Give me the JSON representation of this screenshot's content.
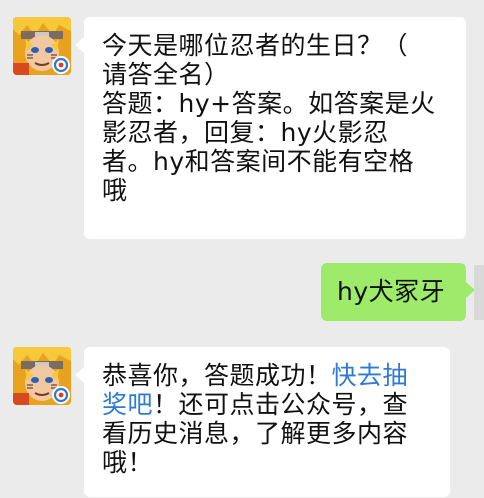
{
  "colors": {
    "background": "#ebebeb",
    "incoming_bubble": "#ffffff",
    "outgoing_bubble": "#9eea6a",
    "link": "#2e7ad6"
  },
  "messages": [
    {
      "sender": "official-account",
      "avatar_icon": "naruto-game-avatar-icon",
      "lines": [
        "今天是哪位忍者的生日？（",
        "请答全名）",
        "答题：hy+答案。如答案是火",
        "影忍者，回复：hy火影忍",
        "者。hy和答案间不能有空格",
        "哦"
      ]
    },
    {
      "sender": "user",
      "text": "hy犬冢牙"
    },
    {
      "sender": "official-account",
      "avatar_icon": "naruto-game-avatar-icon",
      "line1_prefix": "恭喜你，答题成功！",
      "line1_link": "快去抽",
      "line2_link": "奖吧",
      "line2_suffix": "！还可点击公众号，查",
      "line3": "看历史消息，了解更多内容",
      "line4": "哦！"
    }
  ]
}
